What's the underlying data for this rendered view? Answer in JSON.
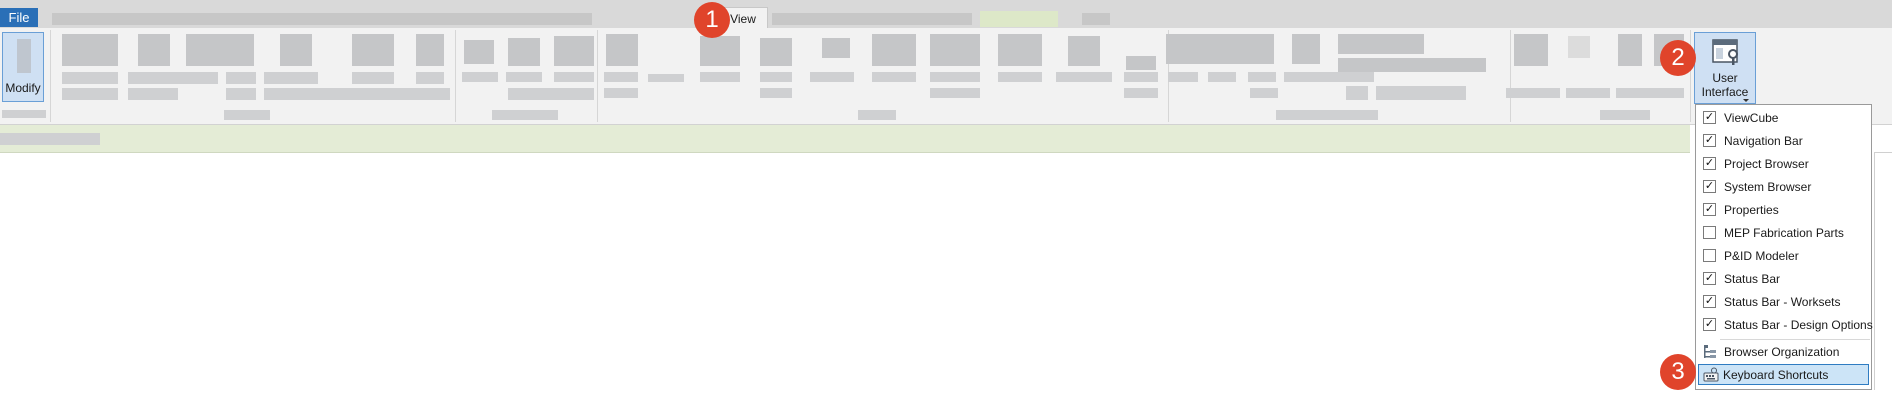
{
  "tabs": {
    "file_label": "File",
    "view_label": "View"
  },
  "ribbon": {
    "modify_label": "Modify",
    "user_interface_label_line1": "User",
    "user_interface_label_line2": "Interface"
  },
  "menu": {
    "items": [
      {
        "label": "ViewCube",
        "checked": true
      },
      {
        "label": "Navigation Bar",
        "checked": true
      },
      {
        "label": "Project Browser",
        "checked": true
      },
      {
        "label": "System Browser",
        "checked": true
      },
      {
        "label": "Properties",
        "checked": true
      },
      {
        "label": "MEP Fabrication Parts",
        "checked": false
      },
      {
        "label": "P&ID Modeler",
        "checked": false
      },
      {
        "label": "Status Bar",
        "checked": true
      },
      {
        "label": "Status Bar - Worksets",
        "checked": true
      },
      {
        "label": "Status Bar - Design Options",
        "checked": true
      }
    ],
    "browser_organization_label": "Browser Organization",
    "keyboard_shortcuts_label": "Keyboard Shortcuts",
    "check_glyph": "✓"
  },
  "callouts": {
    "one": "1",
    "two": "2",
    "three": "3"
  },
  "colors": {
    "accent": "#2a6fb7",
    "callout": "#e0442b",
    "selection": "#cce4f7",
    "options_bar": "#e4ecd6"
  }
}
